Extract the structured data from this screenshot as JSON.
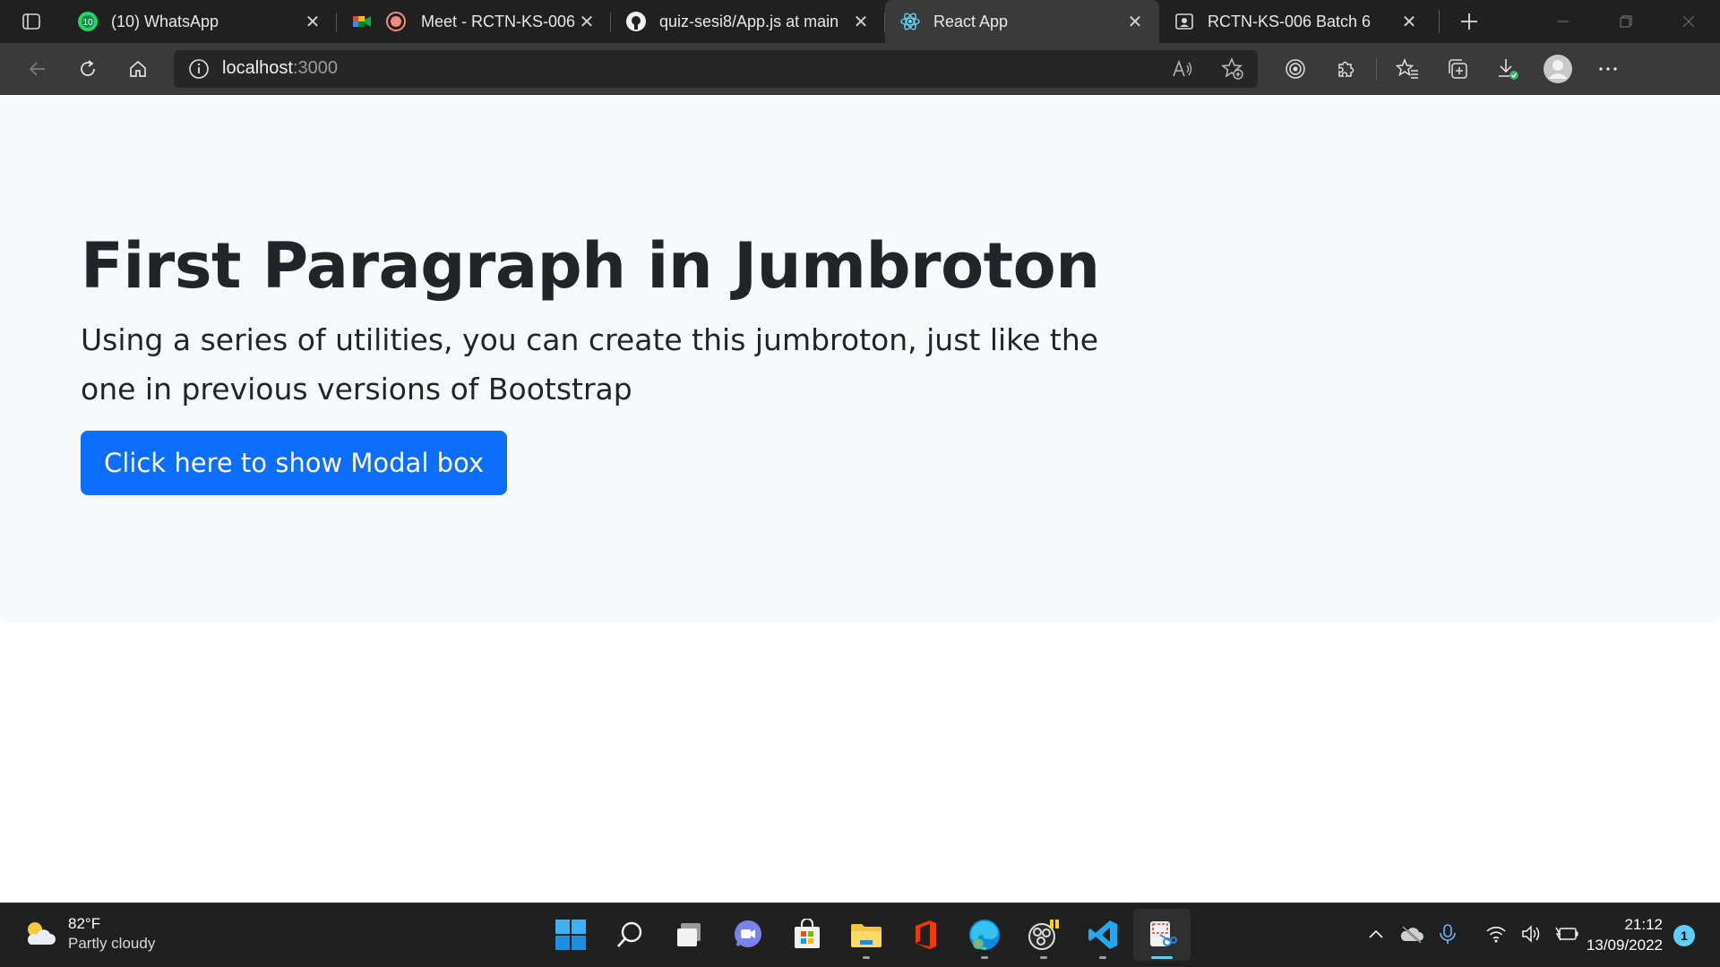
{
  "browser": {
    "tabs": [
      {
        "title": "(10) WhatsApp",
        "icon": "whatsapp-icon",
        "badge": "10",
        "active": false
      },
      {
        "title": "Meet - RCTN-KS-006",
        "icon": "google-meet-icon",
        "active": false
      },
      {
        "title": "quiz-sesi8/App.js at main",
        "icon": "github-icon",
        "active": false
      },
      {
        "title": "React App",
        "icon": "react-icon",
        "active": true
      },
      {
        "title": "RCTN-KS-006 Batch 6",
        "icon": "classroom-icon",
        "active": false
      }
    ],
    "address": {
      "host": "localhost",
      "port": ":3000"
    }
  },
  "page": {
    "title": "First Paragraph in Jumbroton",
    "lead": "Using a series of utilities, you can create this jumbroton, just like the one in previous versions of Bootstrap",
    "button_label": "Click here to show Modal box"
  },
  "taskbar": {
    "weather": {
      "temp": "82°F",
      "condition": "Partly cloudy"
    },
    "clock": {
      "time": "21:12",
      "date": "13/09/2022"
    },
    "notifications": "1"
  },
  "colors": {
    "primary": "#0d6efd",
    "jumbotron_bg": "#f8f9fa",
    "browser_chrome": "#3a3a3a",
    "taskbar": "#202020"
  }
}
